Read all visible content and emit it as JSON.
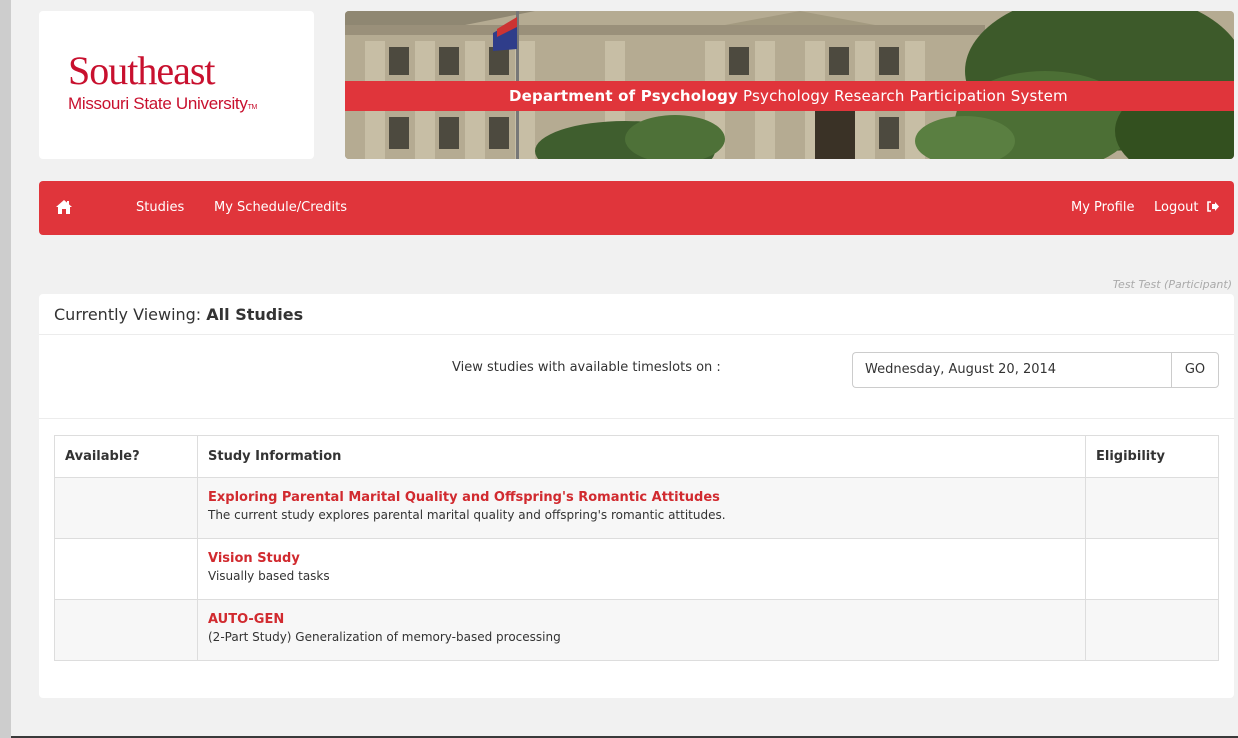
{
  "logo": {
    "main": "Southeast",
    "sub": "Missouri State University",
    "tm": "TM"
  },
  "banner": {
    "dept": "Department of Psychology",
    "system": "Psychology Research Participation System"
  },
  "nav": {
    "home_icon": "home-icon",
    "studies": "Studies",
    "schedule": "My Schedule/Credits",
    "profile": "My Profile",
    "logout": "Logout",
    "logout_icon": "sign-out-icon"
  },
  "user": {
    "label": "Test Test (Participant)"
  },
  "panel": {
    "viewing_prefix": "Currently Viewing:",
    "viewing_value": "All Studies",
    "filter_label": "View studies with available timeslots on :",
    "date_value": "Wednesday, August 20, 2014",
    "go_label": "GO"
  },
  "table": {
    "headers": {
      "available": "Available?",
      "info": "Study Information",
      "eligibility": "Eligibility"
    },
    "rows": [
      {
        "available": "",
        "title": "Exploring Parental Marital Quality and Offspring's Romantic Attitudes",
        "desc": "The current study explores parental marital quality and offspring's romantic attitudes.",
        "eligibility": ""
      },
      {
        "available": "",
        "title": "Vision Study",
        "desc": "Visually based tasks",
        "eligibility": ""
      },
      {
        "available": "",
        "title": "AUTO-GEN",
        "desc": "(2-Part Study) Generalization of memory-based processing",
        "eligibility": ""
      }
    ]
  },
  "colors": {
    "brand_red": "#e0353b",
    "link_red": "#d12a2f"
  }
}
